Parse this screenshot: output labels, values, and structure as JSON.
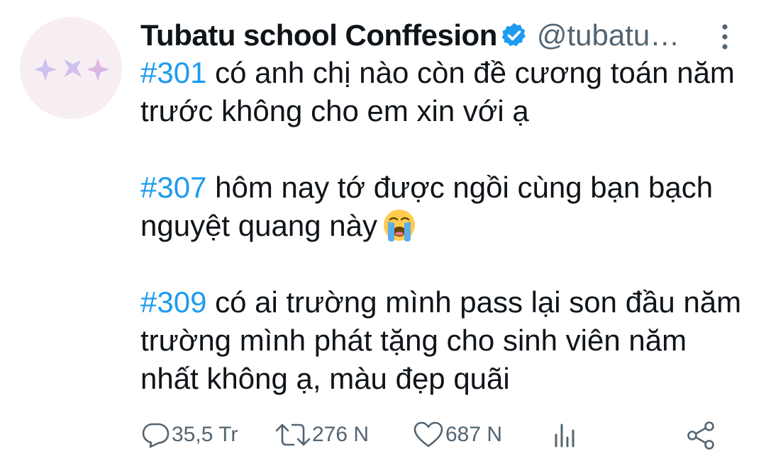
{
  "tweet": {
    "author": {
      "display_name": "Tubatu school Conffesion",
      "handle": "@tubatu…",
      "verified": true
    },
    "entries": [
      {
        "hashtag": "#301",
        "text": " có anh chị nào còn đề cương toán năm trước không cho em xin với ạ"
      },
      {
        "hashtag": "#307",
        "text": " hôm nay tớ được ngồi cùng bạn bạch nguyệt quang này",
        "emoji": "loudly-crying-face"
      },
      {
        "hashtag": "#309",
        "text": " có ai trường mình pass lại son đầu năm trường mình phát tặng cho sinh viên năm nhất không ạ, màu đẹp quãi"
      }
    ],
    "actions": {
      "reply_count": "35,5 Tr",
      "retweet_count": "276 N",
      "like_count": "687 N",
      "views_icon": "analytics-icon",
      "share_icon": "share-icon"
    },
    "colors": {
      "hashtag": "#1d9bf0",
      "verified": "#1d9bf0",
      "secondary": "#536471",
      "text": "#0f1419"
    }
  }
}
